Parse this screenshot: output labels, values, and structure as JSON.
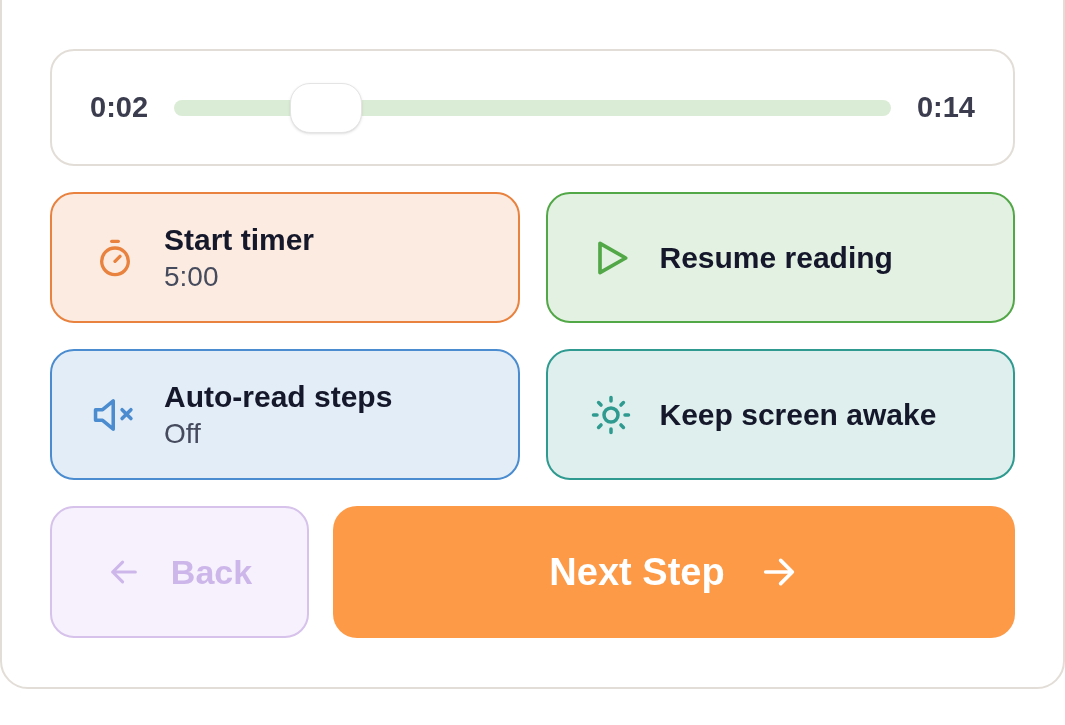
{
  "player": {
    "elapsed": "0:02",
    "total": "0:14",
    "level": 0.18
  },
  "actions": [
    {
      "title": "Start timer",
      "subtitle": "5:00",
      "color": "#e8823e"
    },
    {
      "title": "Resume reading",
      "color": "#52a747"
    },
    {
      "title": "Auto-read steps",
      "subtitle": "Off",
      "color": "#4a8ccf"
    },
    {
      "title": "Keep screen awake",
      "color": "#2e9a90"
    }
  ],
  "navigation": {
    "back": {
      "label": "Back",
      "disabled": true
    },
    "next": {
      "label": "Next Step",
      "disabled": false
    }
  }
}
